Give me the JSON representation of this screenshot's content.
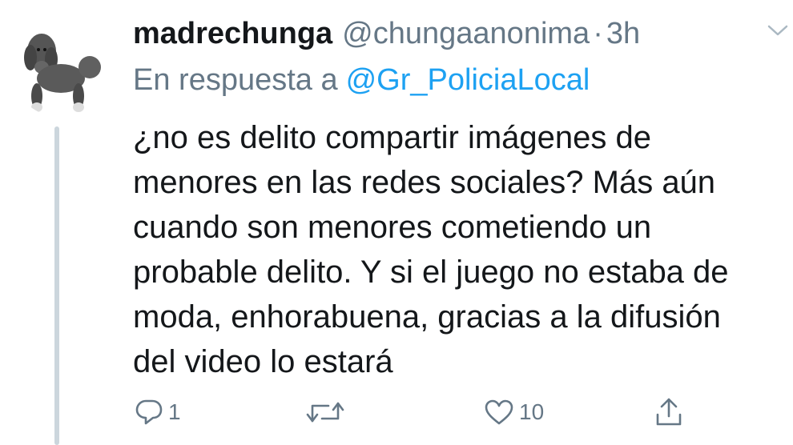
{
  "tweet": {
    "display_name": "madrechunga",
    "handle": "@chungaanonima",
    "separator": "·",
    "time": "3h",
    "reply_prefix": "En respuesta a",
    "reply_to": "@Gr_PoliciaLocal",
    "text": "¿no es delito compartir imágenes de\nmenores en las redes sociales? Más aún\ncuando son menores cometiendo un\nprobable delito. Y si el juego no estaba de\nmoda, enhorabuena, gracias a la difusión\ndel video lo estará",
    "avatar_icon": "poodle-avatar"
  },
  "actions": {
    "reply": {
      "icon": "reply-icon",
      "count": "1"
    },
    "retweet": {
      "icon": "retweet-icon",
      "count": ""
    },
    "like": {
      "icon": "heart-icon",
      "count": "10"
    },
    "share": {
      "icon": "share-icon"
    }
  },
  "colors": {
    "text": "#14171a",
    "secondary": "#657786",
    "link": "#1da1f2",
    "thread_line": "#ccd6dd"
  }
}
